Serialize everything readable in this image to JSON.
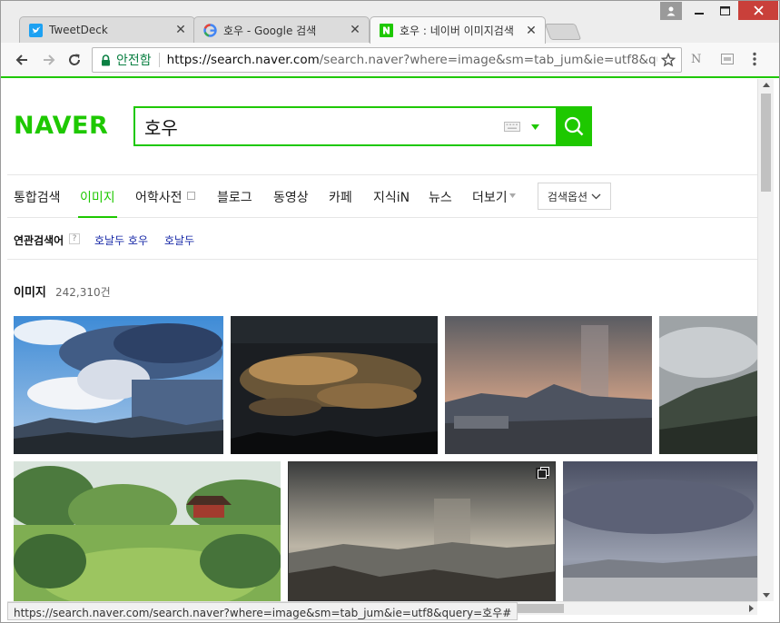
{
  "browser": {
    "tabs": [
      {
        "title": "TweetDeck",
        "icon": "twitter-icon"
      },
      {
        "title": "호우 - Google 검색",
        "icon": "google-icon"
      },
      {
        "title": "호우 : 네이버 이미지검색",
        "icon": "naver-icon"
      }
    ],
    "omnibox": {
      "secure_label": "안전함",
      "url_host": "https://search.naver.com",
      "url_rest": "/search.naver?where=image&sm=tab_jum&ie=utf8&query="
    },
    "toolbar_ext": "N"
  },
  "page": {
    "logo": "NAVER",
    "query": "호우",
    "search_tabs": [
      "통합검색",
      "이미지",
      "어학사전",
      "블로그",
      "동영상",
      "카페",
      "지식iN",
      "뉴스",
      "더보기"
    ],
    "active_tab": "이미지",
    "option_button": "검색옵션",
    "related_label": "연관검색어",
    "related_help": "?",
    "related_links": [
      "호날두 호우",
      "호날두"
    ],
    "result_title": "이미지",
    "result_count": "242,310건"
  },
  "status_url": "https://search.naver.com/search.naver?where=image&sm=tab_jum&ie=utf8&query=호우#",
  "colors": {
    "naver_green": "#1ec800",
    "close_red": "#c9403a",
    "link_blue": "#1a2ba8"
  }
}
